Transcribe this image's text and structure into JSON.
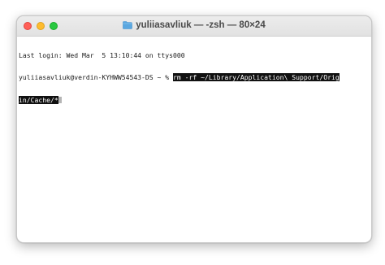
{
  "window": {
    "title": "yuliiasavliuk — -zsh — 80×24",
    "folder_icon": "folder-icon",
    "accent": {
      "close": "#ff5f57",
      "minimize": "#febc2e",
      "zoom": "#28c840",
      "folder": "#5aa7e0"
    }
  },
  "terminal": {
    "last_login": "Last login: Wed Mar  5 13:10:44 on ttys000",
    "prompt": "yuliiasavliuk@verdin-KYHWW54543-DS ~ % ",
    "command_line1": "rm -rf ~/Library/Application\\ Support/Orig",
    "command_line2": "in/Cache/*"
  }
}
